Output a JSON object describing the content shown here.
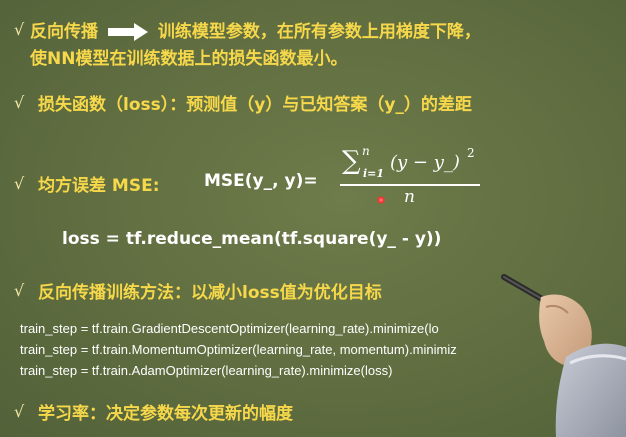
{
  "bullets": {
    "check_glyph": "√",
    "b1": {
      "part1": "反向传播",
      "part2": "训练模型参数，在所有参数上用梯度下降，",
      "line2": "使NN模型在训练数据上的损失函数最小。"
    },
    "b2": {
      "text": "损失函数（loss）：预测值（y）与已知答案（y_）的差距"
    },
    "b3": {
      "label": "均方误差 MSE:",
      "mse_prefix": "MSE(y_, y)=",
      "sum_symbol": "∑",
      "sum_upper": "n",
      "sum_lower": "i=1",
      "numerator_body": "(y − y_)",
      "numerator_exp": "2",
      "denominator": "n",
      "code": "loss = tf.reduce_mean(tf.square(y_ - y))"
    },
    "b4": {
      "text": "反向传播训练方法：以减小loss值为优化目标",
      "code1": "train_step = tf.train.GradientDescentOptimizer(learning_rate).minimize(lo",
      "code2": "train_step = tf.train.MomentumOptimizer(learning_rate, momentum).minimiz",
      "code3": "train_step = tf.train.AdamOptimizer(learning_rate).minimize(loss)"
    },
    "b5": {
      "text": "学习率：决定参数每次更新的幅度"
    }
  },
  "colors": {
    "background": "#5d6b3f",
    "highlight": "#f6d84a",
    "text": "#ffffff"
  },
  "icons": [
    "right-arrow-icon",
    "check-icon",
    "laser-pointer-icon",
    "presenter-hand-icon"
  ]
}
